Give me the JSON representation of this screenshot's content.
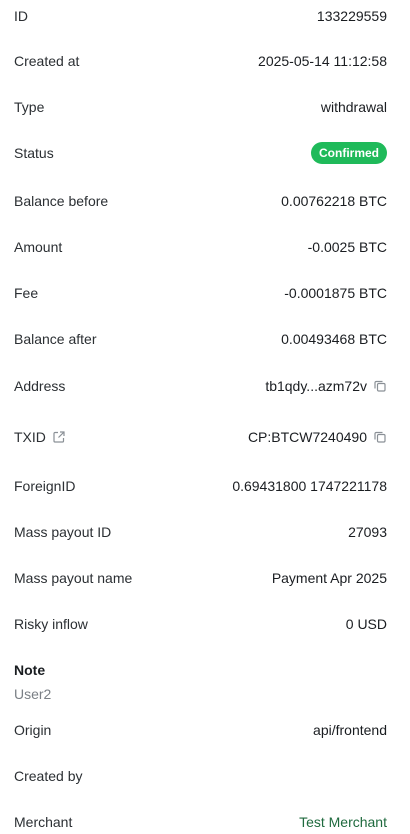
{
  "fields": {
    "id": {
      "label": "ID",
      "value": "133229559"
    },
    "created_at": {
      "label": "Created at",
      "value": "2025-05-14 11:12:58"
    },
    "type": {
      "label": "Type",
      "value": "withdrawal"
    },
    "status": {
      "label": "Status",
      "value": "Confirmed",
      "color": "#1fba5a"
    },
    "balance_before": {
      "label": "Balance before",
      "value": "0.00762218 BTC"
    },
    "amount": {
      "label": "Amount",
      "value": "-0.0025 BTC"
    },
    "fee": {
      "label": "Fee",
      "value": "-0.0001875 BTC"
    },
    "balance_after": {
      "label": "Balance after",
      "value": "0.00493468 BTC"
    },
    "address": {
      "label": "Address",
      "value": "tb1qdy...azm72v",
      "icon": "copy-icon"
    },
    "txid": {
      "label": "TXID",
      "value": "CP:BTCW7240490",
      "label_icon": "external-link-icon",
      "icon": "copy-icon"
    },
    "foreign_id": {
      "label": "ForeignID",
      "value": "0.69431800 1747221178"
    },
    "mass_payout_id": {
      "label": "Mass payout ID",
      "value": "27093"
    },
    "mass_payout_name": {
      "label": "Mass payout name",
      "value": "Payment Apr 2025"
    },
    "risky_inflow": {
      "label": "Risky inflow",
      "value": "0 USD"
    },
    "origin": {
      "label": "Origin",
      "value": "api/frontend"
    },
    "created_by": {
      "label": "Created by",
      "value": ""
    },
    "merchant": {
      "label": "Merchant",
      "value": "Test Merchant",
      "color": "#1f6a3e"
    }
  },
  "note": {
    "title": "Note",
    "text": "User2"
  }
}
